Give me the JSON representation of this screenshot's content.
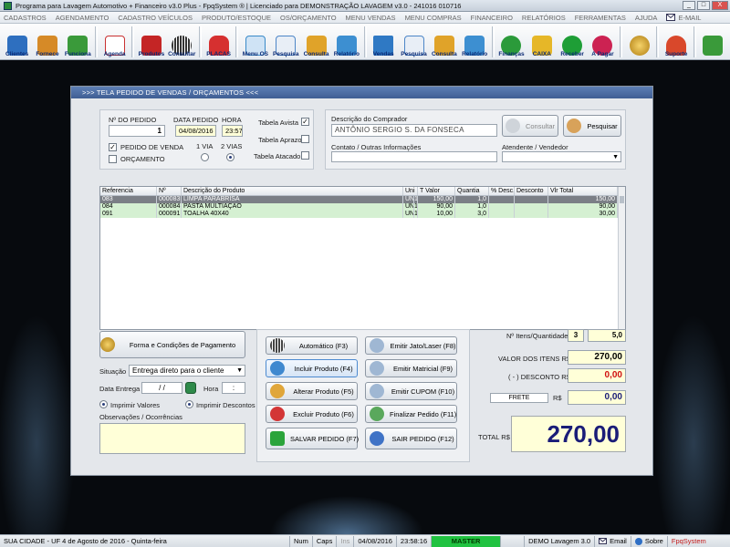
{
  "window": {
    "title": "Programa para Lavagem Automotivo + Financeiro v3.0 Plus - FpqSystem ® | Licenciado para  DEMONSTRAÇÃO LAVAGEM v3.0 - 241016 010716",
    "buttons": [
      "_",
      "□",
      "X"
    ]
  },
  "menu": [
    "CADASTROS",
    "AGENDAMENTO",
    "CADASTRO VEÍCULOS",
    "PRODUTO/ESTOQUE",
    "OS/ORÇAMENTO",
    "MENU VENDAS",
    "MENU COMPRAS",
    "FINANCEIRO",
    "RELATÓRIOS",
    "FERRAMENTAS",
    "AJUDA",
    "E-MAIL"
  ],
  "toolbar": [
    {
      "label": "Clientes",
      "icon": "clientes-icon",
      "color": "#2e6fbf"
    },
    {
      "label": "Fornece",
      "icon": "fornecedores-icon",
      "color": "#d68a27"
    },
    {
      "label": "Funciona",
      "icon": "funcionarios-icon",
      "color": "#3a9a3a"
    },
    {
      "label": "Agenda",
      "icon": "agenda-icon",
      "color": "#c93131"
    },
    {
      "label": "Produtos",
      "icon": "produtos-icon",
      "color": "#c42525"
    },
    {
      "label": "Consultar",
      "icon": "barcode-icon",
      "color": "#5a5a5a"
    },
    {
      "label": "PLACAS",
      "icon": "car-icon",
      "color": "#d63030"
    },
    {
      "label": "Menu OS",
      "icon": "os-icon",
      "color": "#3a8ac8"
    },
    {
      "label": "Pesquisa",
      "icon": "pesquisa-icon",
      "color": "#4d86c7"
    },
    {
      "label": "Consulta",
      "icon": "consulta-folder-icon",
      "color": "#e0a329"
    },
    {
      "label": "Relatório",
      "icon": "relatorio-icon",
      "color": "#3d8fd1"
    },
    {
      "label": "Vendas",
      "icon": "vendas-monitor-icon",
      "color": "#2f79c4"
    },
    {
      "label": "Pesquisa",
      "icon": "pesquisa-vendas-icon",
      "color": "#4d86c7"
    },
    {
      "label": "Consulta",
      "icon": "consulta-vendas-icon",
      "color": "#e0a329"
    },
    {
      "label": "Relatório",
      "icon": "relatorio-vendas-icon",
      "color": "#3d8fd1"
    },
    {
      "label": "Finanças",
      "icon": "financas-icon",
      "color": "#2b9a3a"
    },
    {
      "label": "CAIXA",
      "icon": "caixa-icon",
      "color": "#e6b728"
    },
    {
      "label": "Receber",
      "icon": "receber-icon",
      "color": "#1e9e36"
    },
    {
      "label": "A Pagar",
      "icon": "pagar-icon",
      "color": "#cc2252"
    },
    {
      "label": "",
      "icon": "coin-icon",
      "color": "#c8961a"
    },
    {
      "label": "Suporte",
      "icon": "suporte-icon",
      "color": "#d9482b"
    },
    {
      "label": "",
      "icon": "exit-icon",
      "color": "#3a9a3a"
    }
  ],
  "form": {
    "header": ">>>   TELA PEDIDO DE VENDAS / ORÇAMENTOS   <<<",
    "numero_pedido_label": "Nº DO PEDIDO",
    "numero_pedido": "1",
    "data_pedido_label": "DATA PEDIDO",
    "data_pedido": "04/08/2016",
    "hora_label": "HORA",
    "hora": "23:57",
    "pedido_venda_label": "PEDIDO DE VENDA",
    "orcamento_label": "ORÇAMENTO",
    "via1_label": "1 VIA",
    "via2_label": "2 VIAS",
    "tabela_avista_label": "Tabela Avista",
    "tabela_aprazo_label": "Tabela Aprazo",
    "tabela_atacado_label": "Tabela Atacado",
    "comprador_label": "Descrição do Comprador",
    "comprador": "ANTÔNIO SERGIO S. DA FONSECA",
    "consultar_label": "Consultar",
    "pesquisar_label": "Pesquisar",
    "contato_label": "Contato / Outras Informações",
    "contato": "",
    "atendente_label": "Atendente / Vendedor",
    "atendente": ""
  },
  "table": {
    "headers": [
      "Referencia",
      "Nº",
      "Descrição do Produto",
      "Uni",
      "T Valor",
      "Quantia",
      "% Desc.",
      "Desconto",
      "Vlr Total"
    ],
    "rows": [
      [
        "083",
        "000083",
        "LIMPA PARABRISA",
        "UNI",
        "1",
        "150,00",
        "1,0",
        "",
        "",
        "150,00"
      ],
      [
        "084",
        "000084",
        "PASTA MULTIAÇÃO",
        "UNI",
        "1",
        "90,00",
        "1,0",
        "",
        "",
        "90,00"
      ],
      [
        "091",
        "000091",
        "TOALHA 40X40",
        "UNI",
        "1",
        "10,00",
        "3,0",
        "",
        "",
        "30,00"
      ]
    ]
  },
  "lower_left": {
    "pagamento_label": "Forma e Condições de Pagamento",
    "situacao_label": "Situação",
    "situacao": "Entrega direto para o cliente",
    "data_entrega_label": "Data Entrega",
    "data_entrega": "/   /",
    "hora_label": "Hora",
    "hora": ":",
    "imprimir_valores_label": "Imprimir Valores",
    "imprimir_descontos_label": "Imprimir Descontos",
    "observacoes_label": "Observações / Ocorrências",
    "observacoes": ""
  },
  "actions": {
    "automatico": "Automático     (F3)",
    "incluir": "Incluir Produto  (F4)",
    "alterar": "Alterar Produto  (F5)",
    "excluir": "Excluir Produto  (F6)",
    "salvar": "SALVAR PEDIDO (F7)",
    "jato": "Emitir Jato/Laser (F8)",
    "matricial": "Emitir Matricial  (F9)",
    "cupom": "Emitir CUPOM   (F10)",
    "finalizar": "Finalizar Pedido  (F11)",
    "sair": "SAIR  PEDIDO  (F12)"
  },
  "totals": {
    "itens_label": "Nº Itens/Quantidade",
    "itens": "3",
    "quantidade": "5,0",
    "valor_itens_label": "VALOR DOS ITENS R$",
    "valor_itens": "270,00",
    "desconto_label": "( - ) DESCONTO R$",
    "desconto": "0,00",
    "frete_label": "FRETE",
    "frete_currency": "R$",
    "frete": "0,00",
    "total_label": "TOTAL R$",
    "total": "270,00"
  },
  "status": {
    "cidade": "SUA CIDADE - UF  4 de Agosto de 2016 - Quinta-feira",
    "num": "Num",
    "caps": "Caps",
    "ins": "Ins",
    "data": "04/08/2016",
    "hora": "23:58:16",
    "master": "MASTER",
    "versao": "DEMO Lavagem 3.0",
    "email": "Email",
    "sobre": "Sobre",
    "brand": "FpqSystem"
  }
}
